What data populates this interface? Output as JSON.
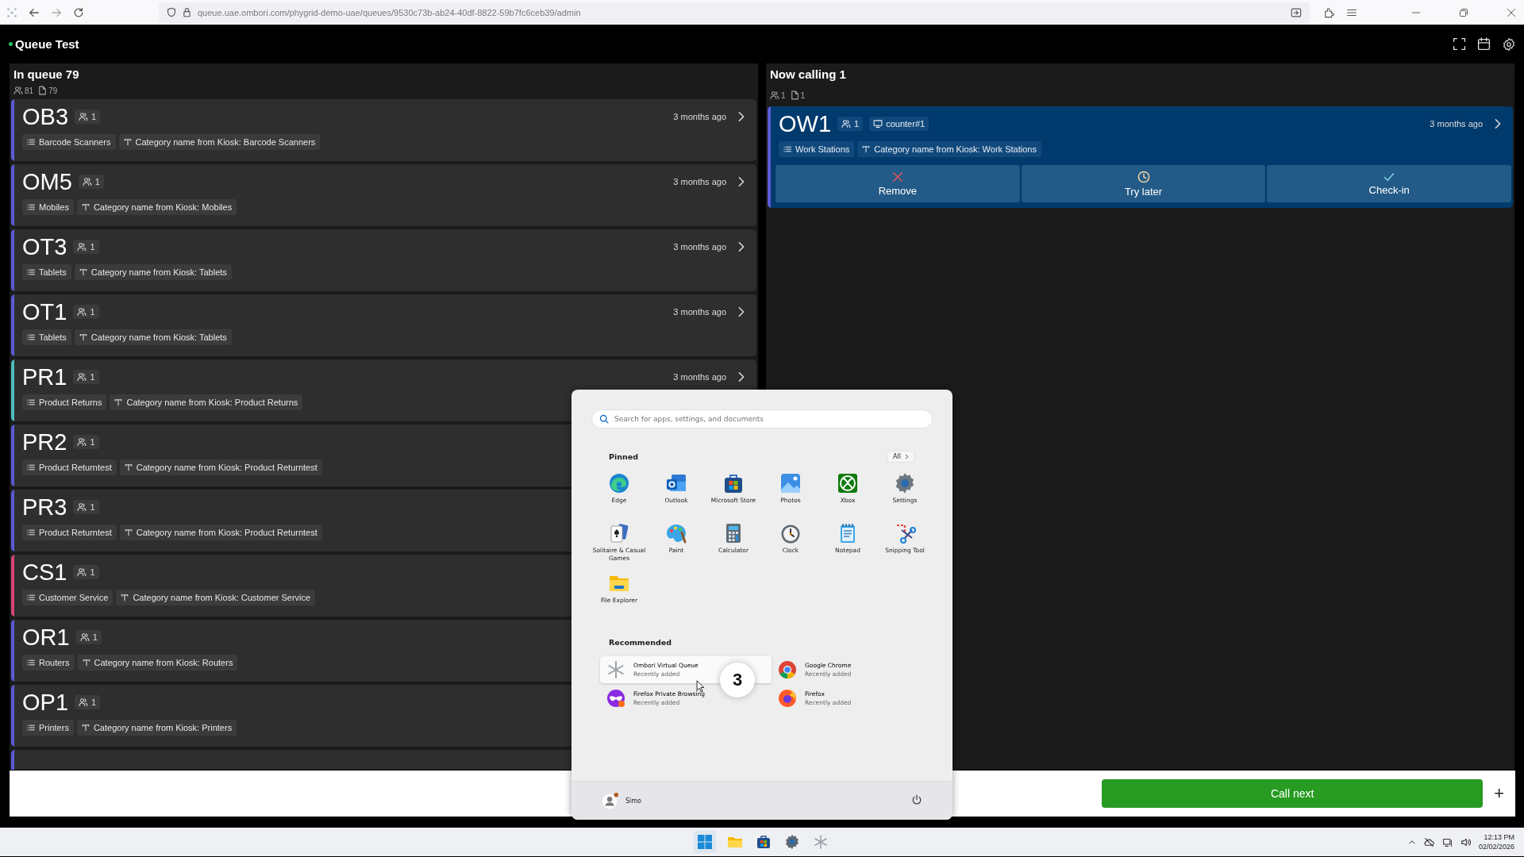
{
  "browser": {
    "url": "queue.uae.ombori.com/phygrid-demo-uae/queues/9530c73b-ab24-40df-8822-59b7fc6ceb39/admin"
  },
  "app": {
    "title": "Queue Test",
    "online": true
  },
  "queue": {
    "title": "In queue 79",
    "people": "81",
    "tickets": "79",
    "items": [
      {
        "code": "OB3",
        "count": "1",
        "time": "3 months ago",
        "color": "#5b5bd6",
        "tags": [
          {
            "kind": "list",
            "label": "Barcode Scanners"
          },
          {
            "kind": "text",
            "label": "Category name from Kiosk: Barcode Scanners"
          }
        ]
      },
      {
        "code": "OM5",
        "count": "1",
        "time": "3 months ago",
        "color": "#5b5bd6",
        "tags": [
          {
            "kind": "list",
            "label": "Mobiles"
          },
          {
            "kind": "text",
            "label": "Category name from Kiosk: Mobiles"
          }
        ]
      },
      {
        "code": "OT3",
        "count": "1",
        "time": "3 months ago",
        "color": "#5b5bd6",
        "tags": [
          {
            "kind": "list",
            "label": "Tablets"
          },
          {
            "kind": "text",
            "label": "Category name from Kiosk: Tablets"
          }
        ]
      },
      {
        "code": "OT1",
        "count": "1",
        "time": "3 months ago",
        "color": "#5b5bd6",
        "tags": [
          {
            "kind": "list",
            "label": "Tablets"
          },
          {
            "kind": "text",
            "label": "Category name from Kiosk: Tablets"
          }
        ]
      },
      {
        "code": "PR1",
        "count": "1",
        "time": "3 months ago",
        "color": "#4cbcbc",
        "tags": [
          {
            "kind": "list",
            "label": "Product Returns"
          },
          {
            "kind": "text",
            "label": "Category name from Kiosk: Product Returns"
          }
        ]
      },
      {
        "code": "PR2",
        "count": "1",
        "color": "#5b5bd6",
        "tags": [
          {
            "kind": "list",
            "label": "Product Returntest"
          },
          {
            "kind": "text",
            "label": "Category name from Kiosk: Product Returntest"
          }
        ]
      },
      {
        "code": "PR3",
        "count": "1",
        "color": "#5b5bd6",
        "tags": [
          {
            "kind": "list",
            "label": "Product Returntest"
          },
          {
            "kind": "text",
            "label": "Category name from Kiosk: Product Returntest"
          }
        ]
      },
      {
        "code": "CS1",
        "count": "1",
        "color": "#d6457a",
        "tags": [
          {
            "kind": "list",
            "label": "Customer Service"
          },
          {
            "kind": "text",
            "label": "Category name from Kiosk: Customer Service"
          }
        ]
      },
      {
        "code": "OR1",
        "count": "1",
        "color": "#5b5bd6",
        "tags": [
          {
            "kind": "list",
            "label": "Routers"
          },
          {
            "kind": "text",
            "label": "Category name from Kiosk: Routers"
          }
        ]
      },
      {
        "code": "OP1",
        "count": "1",
        "color": "#5b5bd6",
        "tags": [
          {
            "kind": "list",
            "label": "Printers"
          },
          {
            "kind": "text",
            "label": "Category name from Kiosk: Printers"
          }
        ]
      }
    ]
  },
  "calling": {
    "title": "Now calling 1",
    "people": "1",
    "tickets": "1",
    "items": [
      {
        "code": "OW1",
        "count": "1",
        "counter": "counter#1",
        "time": "3 months ago",
        "color": "#5b5bd6",
        "tags": [
          {
            "kind": "list",
            "label": "Work Stations"
          },
          {
            "kind": "text",
            "label": "Category name from Kiosk: Work Stations"
          }
        ],
        "actions": [
          {
            "kind": "remove",
            "label": "Remove"
          },
          {
            "kind": "later",
            "label": "Try later"
          },
          {
            "kind": "checkin",
            "label": "Check-in"
          }
        ]
      }
    ]
  },
  "footer": {
    "button": "Call next",
    "add": "+"
  },
  "start_menu": {
    "search": {
      "placeholder": "Search for apps, settings, and documents"
    },
    "pinned_title": "Pinned",
    "all_button": "All",
    "pinned": [
      "Edge",
      "Outlook",
      "Microsoft Store",
      "Photos",
      "Xbox",
      "Settings",
      "Solitaire & Casual Games",
      "Paint",
      "Calculator",
      "Clock",
      "Notepad",
      "Snipping Tool",
      "File Explorer"
    ],
    "recommended_title": "Recommended",
    "recommended": [
      {
        "name": "Ombori Virtual Queue",
        "subtitle": "Recently added",
        "hovered": true
      },
      {
        "name": "Google Chrome",
        "subtitle": "Recently added",
        "hovered": false
      },
      {
        "name": "Firefox Private Browsing",
        "subtitle": "Recently added",
        "hovered": false
      },
      {
        "name": "Firefox",
        "subtitle": "Recently added",
        "hovered": false
      }
    ],
    "user": "Simo",
    "step_marker": "3"
  },
  "taskbar": {
    "time": "12:13 PM",
    "date": "02/02/2026"
  }
}
